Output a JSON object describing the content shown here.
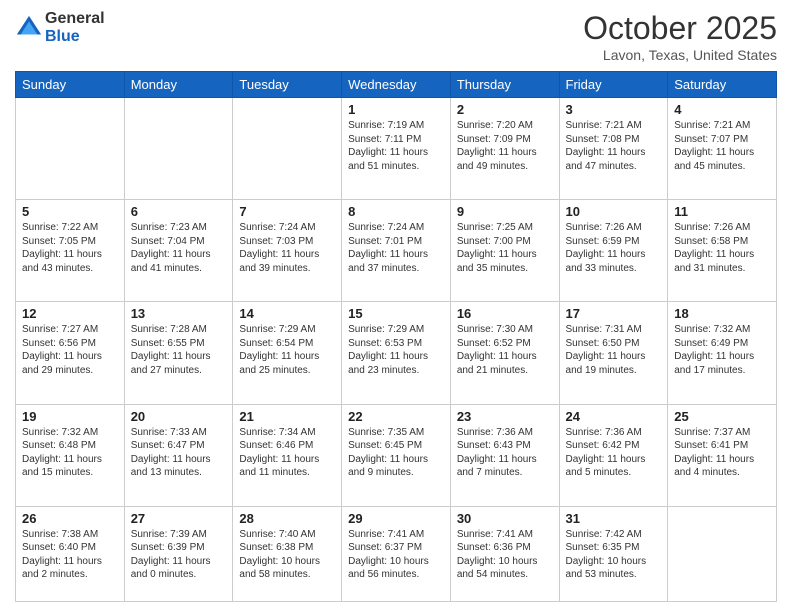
{
  "header": {
    "logo_general": "General",
    "logo_blue": "Blue",
    "month_title": "October 2025",
    "location": "Lavon, Texas, United States"
  },
  "days_of_week": [
    "Sunday",
    "Monday",
    "Tuesday",
    "Wednesday",
    "Thursday",
    "Friday",
    "Saturday"
  ],
  "weeks": [
    [
      {
        "day": "",
        "info": ""
      },
      {
        "day": "",
        "info": ""
      },
      {
        "day": "",
        "info": ""
      },
      {
        "day": "1",
        "info": "Sunrise: 7:19 AM\nSunset: 7:11 PM\nDaylight: 11 hours\nand 51 minutes."
      },
      {
        "day": "2",
        "info": "Sunrise: 7:20 AM\nSunset: 7:09 PM\nDaylight: 11 hours\nand 49 minutes."
      },
      {
        "day": "3",
        "info": "Sunrise: 7:21 AM\nSunset: 7:08 PM\nDaylight: 11 hours\nand 47 minutes."
      },
      {
        "day": "4",
        "info": "Sunrise: 7:21 AM\nSunset: 7:07 PM\nDaylight: 11 hours\nand 45 minutes."
      }
    ],
    [
      {
        "day": "5",
        "info": "Sunrise: 7:22 AM\nSunset: 7:05 PM\nDaylight: 11 hours\nand 43 minutes."
      },
      {
        "day": "6",
        "info": "Sunrise: 7:23 AM\nSunset: 7:04 PM\nDaylight: 11 hours\nand 41 minutes."
      },
      {
        "day": "7",
        "info": "Sunrise: 7:24 AM\nSunset: 7:03 PM\nDaylight: 11 hours\nand 39 minutes."
      },
      {
        "day": "8",
        "info": "Sunrise: 7:24 AM\nSunset: 7:01 PM\nDaylight: 11 hours\nand 37 minutes."
      },
      {
        "day": "9",
        "info": "Sunrise: 7:25 AM\nSunset: 7:00 PM\nDaylight: 11 hours\nand 35 minutes."
      },
      {
        "day": "10",
        "info": "Sunrise: 7:26 AM\nSunset: 6:59 PM\nDaylight: 11 hours\nand 33 minutes."
      },
      {
        "day": "11",
        "info": "Sunrise: 7:26 AM\nSunset: 6:58 PM\nDaylight: 11 hours\nand 31 minutes."
      }
    ],
    [
      {
        "day": "12",
        "info": "Sunrise: 7:27 AM\nSunset: 6:56 PM\nDaylight: 11 hours\nand 29 minutes."
      },
      {
        "day": "13",
        "info": "Sunrise: 7:28 AM\nSunset: 6:55 PM\nDaylight: 11 hours\nand 27 minutes."
      },
      {
        "day": "14",
        "info": "Sunrise: 7:29 AM\nSunset: 6:54 PM\nDaylight: 11 hours\nand 25 minutes."
      },
      {
        "day": "15",
        "info": "Sunrise: 7:29 AM\nSunset: 6:53 PM\nDaylight: 11 hours\nand 23 minutes."
      },
      {
        "day": "16",
        "info": "Sunrise: 7:30 AM\nSunset: 6:52 PM\nDaylight: 11 hours\nand 21 minutes."
      },
      {
        "day": "17",
        "info": "Sunrise: 7:31 AM\nSunset: 6:50 PM\nDaylight: 11 hours\nand 19 minutes."
      },
      {
        "day": "18",
        "info": "Sunrise: 7:32 AM\nSunset: 6:49 PM\nDaylight: 11 hours\nand 17 minutes."
      }
    ],
    [
      {
        "day": "19",
        "info": "Sunrise: 7:32 AM\nSunset: 6:48 PM\nDaylight: 11 hours\nand 15 minutes."
      },
      {
        "day": "20",
        "info": "Sunrise: 7:33 AM\nSunset: 6:47 PM\nDaylight: 11 hours\nand 13 minutes."
      },
      {
        "day": "21",
        "info": "Sunrise: 7:34 AM\nSunset: 6:46 PM\nDaylight: 11 hours\nand 11 minutes."
      },
      {
        "day": "22",
        "info": "Sunrise: 7:35 AM\nSunset: 6:45 PM\nDaylight: 11 hours\nand 9 minutes."
      },
      {
        "day": "23",
        "info": "Sunrise: 7:36 AM\nSunset: 6:43 PM\nDaylight: 11 hours\nand 7 minutes."
      },
      {
        "day": "24",
        "info": "Sunrise: 7:36 AM\nSunset: 6:42 PM\nDaylight: 11 hours\nand 5 minutes."
      },
      {
        "day": "25",
        "info": "Sunrise: 7:37 AM\nSunset: 6:41 PM\nDaylight: 11 hours\nand 4 minutes."
      }
    ],
    [
      {
        "day": "26",
        "info": "Sunrise: 7:38 AM\nSunset: 6:40 PM\nDaylight: 11 hours\nand 2 minutes."
      },
      {
        "day": "27",
        "info": "Sunrise: 7:39 AM\nSunset: 6:39 PM\nDaylight: 11 hours\nand 0 minutes."
      },
      {
        "day": "28",
        "info": "Sunrise: 7:40 AM\nSunset: 6:38 PM\nDaylight: 10 hours\nand 58 minutes."
      },
      {
        "day": "29",
        "info": "Sunrise: 7:41 AM\nSunset: 6:37 PM\nDaylight: 10 hours\nand 56 minutes."
      },
      {
        "day": "30",
        "info": "Sunrise: 7:41 AM\nSunset: 6:36 PM\nDaylight: 10 hours\nand 54 minutes."
      },
      {
        "day": "31",
        "info": "Sunrise: 7:42 AM\nSunset: 6:35 PM\nDaylight: 10 hours\nand 53 minutes."
      },
      {
        "day": "",
        "info": ""
      }
    ]
  ]
}
